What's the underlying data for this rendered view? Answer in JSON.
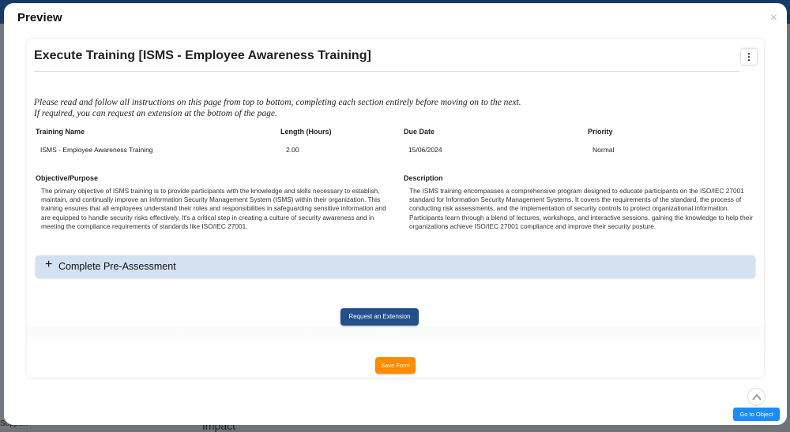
{
  "background": {
    "support": "Support",
    "impact": "Impact"
  },
  "modal": {
    "title": "Preview",
    "close": "×"
  },
  "card": {
    "title": "Execute Training [ISMS - Employee Awareness Training]",
    "menu": "⋮",
    "instructions": [
      "Please read and follow all instructions on this page from top to bottom, completing each section entirely before moving on to the next.",
      "If required, you can request an extension at the bottom of the page."
    ],
    "fields": [
      {
        "label": "Training Name",
        "value": "ISMS - Employee Awareness Training"
      },
      {
        "label": "Length (Hours)",
        "value": "2.00"
      },
      {
        "label": "Due Date",
        "value": "15/06/2024"
      },
      {
        "label": "Priority",
        "value": "Normal"
      }
    ],
    "objective": {
      "label": "Objective/Purpose",
      "text": "The primary objective of ISMS training is to provide participants with the knowledge and skills necessary to establish, maintain, and continually improve an Information Security Management System (ISMS) within their organization. This training ensures that all employees understand their roles and responsibilities in safeguarding sensitive information and are equipped to handle security risks effectively. It's a critical step in creating a culture of security awareness and in meeting the compliance requirements of standards like ISO/IEC 27001."
    },
    "description": {
      "label": "Description",
      "text": "The ISMS training encompasses a comprehensive program designed to educate participants on the ISO/IEC 27001 standard for Information Security Management Systems. It covers the requirements of the standard, the process of conducting risk assessments, and the implementation of security controls to protect organizational information. Participants learn through a blend of lectures, workshops, and interactive sessions, gaining the knowledge to help their organizations achieve ISO/IEC 27001 compliance and improve their security posture."
    },
    "accordion": {
      "icon": "+",
      "label": "Complete Pre-Assessment"
    },
    "request_extension": "Request an Extension",
    "save_form": "Save Form"
  },
  "footer": {
    "go_to_object": "Go to Object"
  }
}
